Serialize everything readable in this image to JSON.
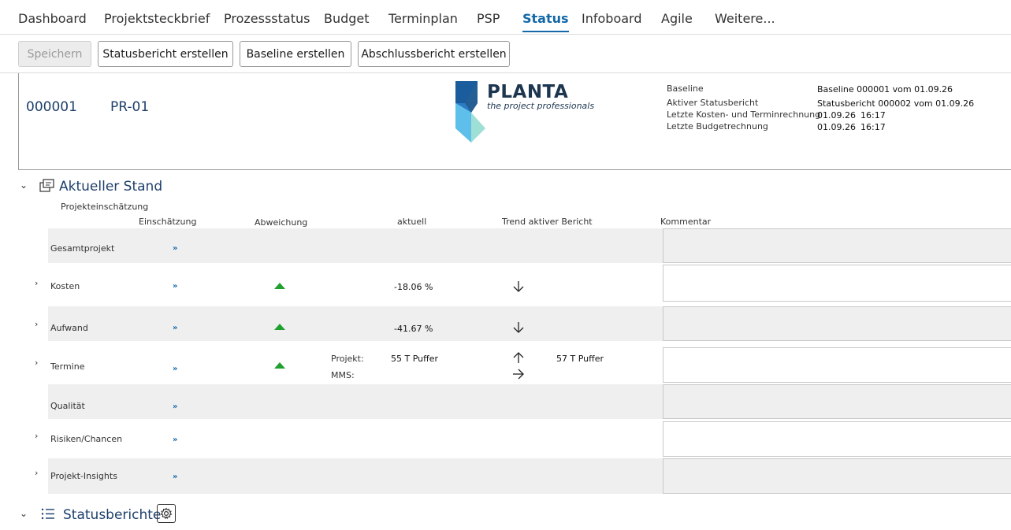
{
  "nav": {
    "items": [
      "Dashboard",
      "Projektsteckbrief",
      "Prozessstatus",
      "Budget",
      "Terminplan",
      "PSP",
      "Status",
      "Infoboard",
      "Agile",
      "Weitere..."
    ],
    "active": "Status"
  },
  "toolbar": {
    "save": "Speichern",
    "status_report": "Statusbericht erstellen",
    "baseline": "Baseline erstellen",
    "final_report": "Abschlussbericht erstellen"
  },
  "header": {
    "project_id": "000001",
    "project_code": "PR-01",
    "logo": {
      "name": "PLANTA",
      "tagline": "the project professionals"
    },
    "meta": {
      "baseline_label": "Baseline",
      "baseline_value": "Baseline 000001 vom 01.09.26",
      "active_report_label": "Aktiver Statusbericht",
      "active_report_value": "Statusbericht 000002 vom 01.09.26",
      "last_cost_label": "Letzte Kosten- und Terminrechnung",
      "last_cost_date": "01.09.26",
      "last_cost_time": "16:17",
      "last_budget_label": "Letzte Budgetrechnung",
      "last_budget_date": "01.09.26",
      "last_budget_time": "16:17"
    }
  },
  "current": {
    "title": "Aktueller Stand",
    "subtitle": "Projekteinschätzung",
    "columns": {
      "assessment": "Einschätzung",
      "deviation": "Abweichung",
      "current": "aktuell",
      "trend": "Trend aktiver Bericht",
      "comment": "Kommentar"
    },
    "link_glyph": "»",
    "rows": {
      "overall": "Gesamtprojekt",
      "costs": {
        "label": "Kosten",
        "value": "-18.06 %"
      },
      "effort": {
        "label": "Aufwand",
        "value": "-41.67 %"
      },
      "dates": {
        "label": "Termine",
        "project_label": "Projekt:",
        "project_value": "55 T Puffer",
        "mms_label": "MMS:",
        "trend_value": "57 T Puffer"
      },
      "quality": "Qualität",
      "risks": "Risiken/Chancen",
      "insights": "Projekt-Insights"
    },
    "colors": {
      "deviation_good": "#1fa02f",
      "accent": "#1268a8"
    }
  },
  "reports": {
    "title": "Statusberichte"
  }
}
